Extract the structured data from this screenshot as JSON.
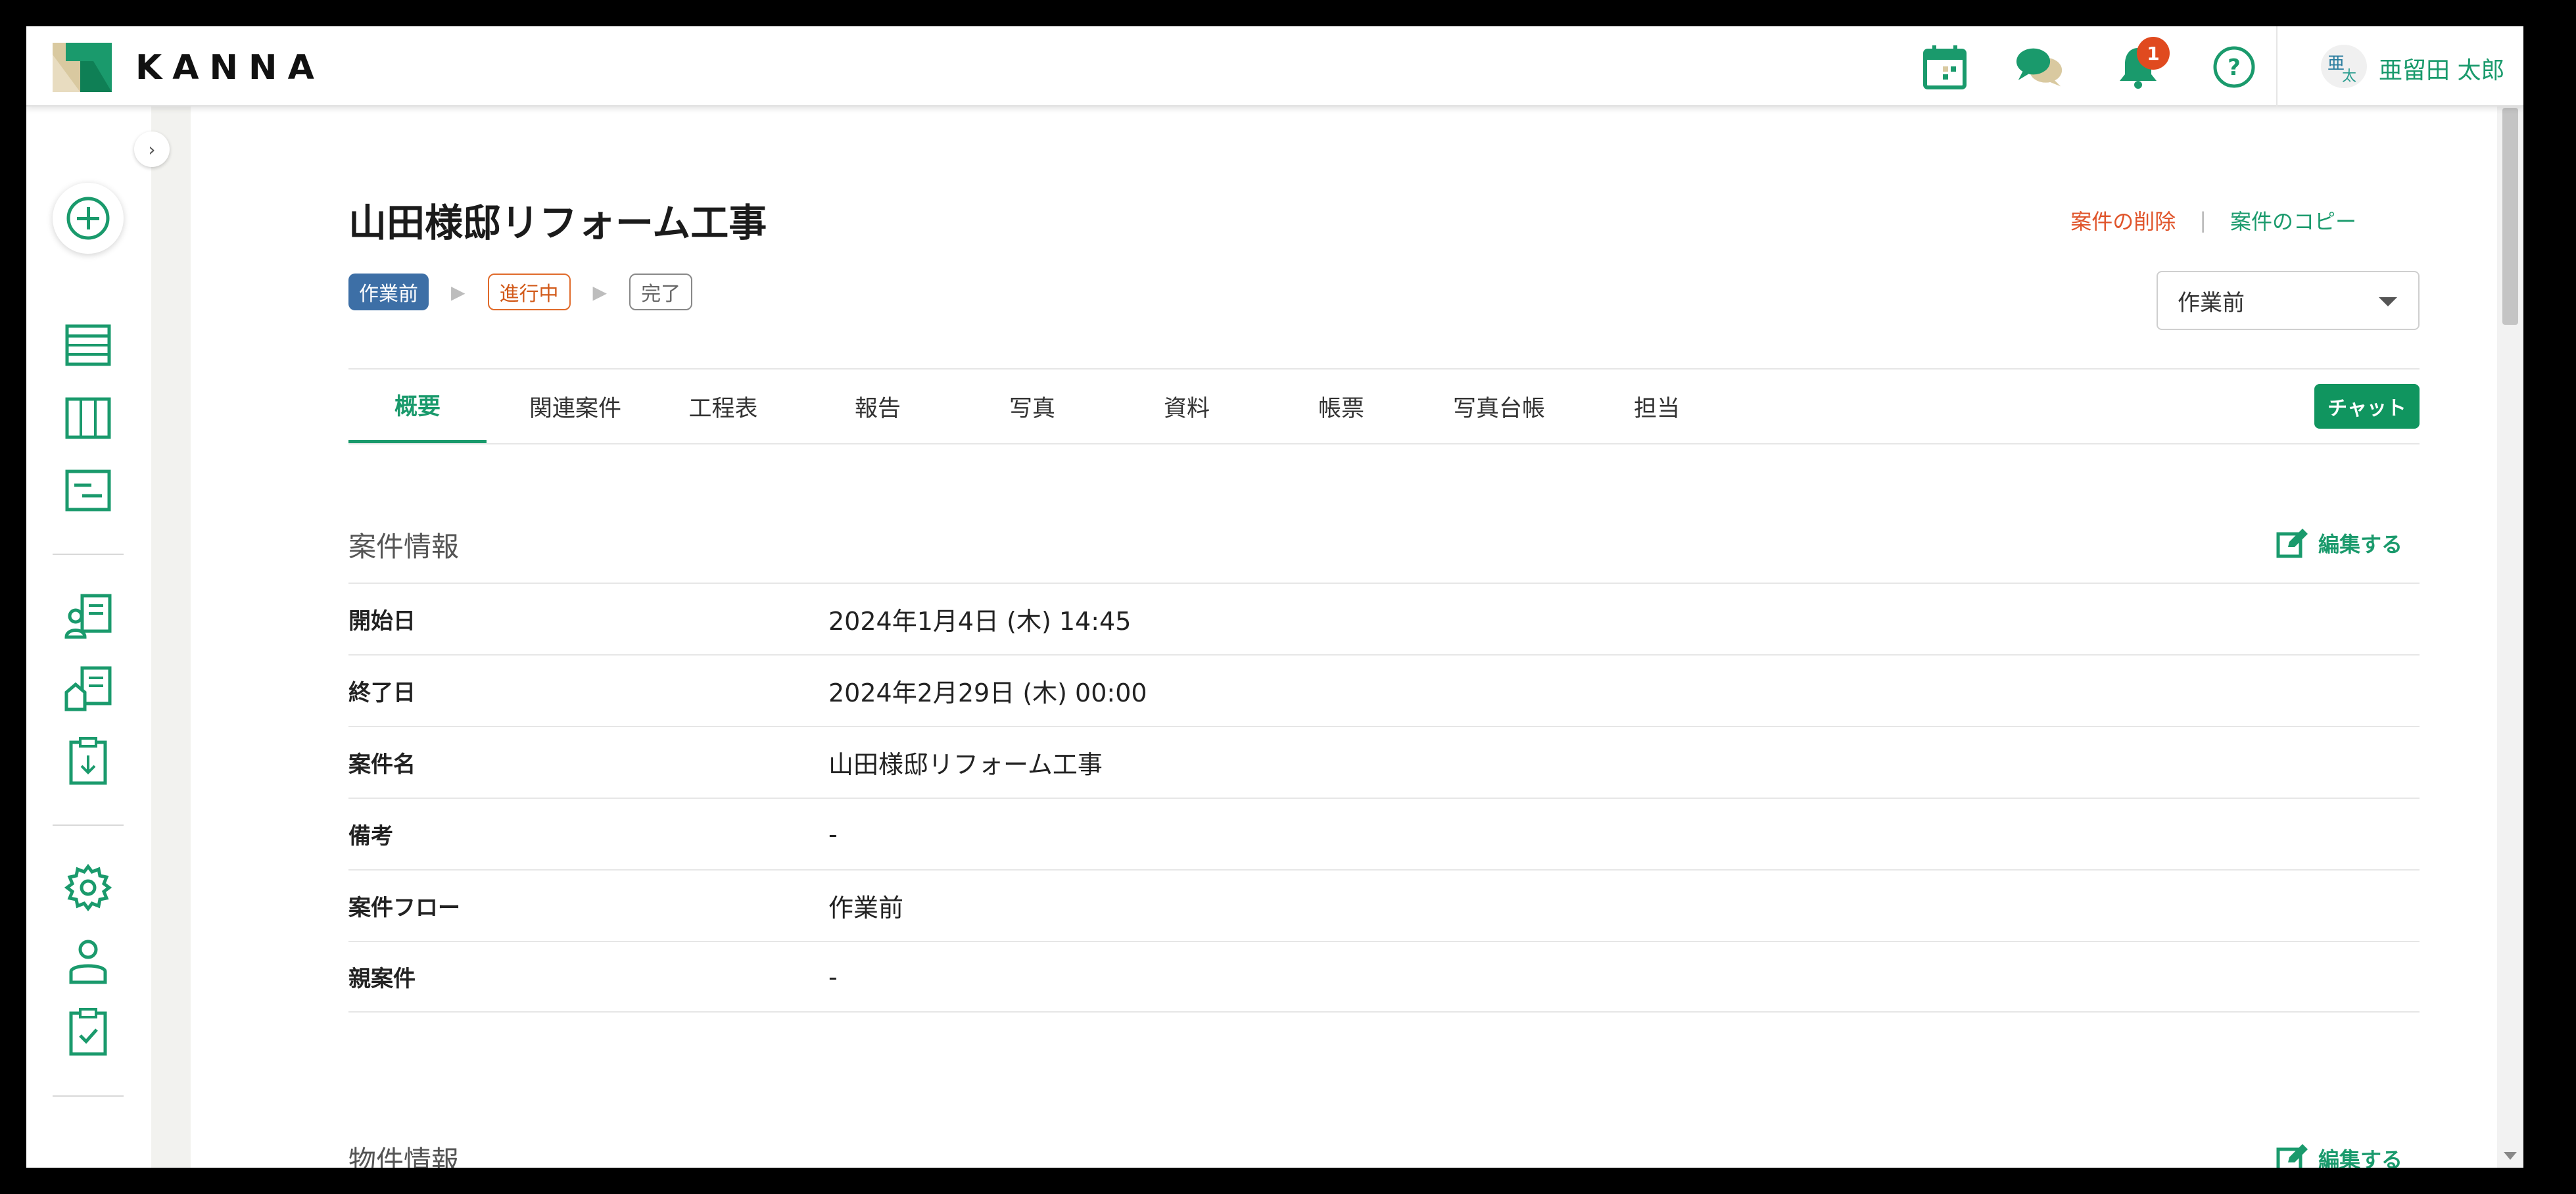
{
  "app": {
    "logo_text": "KANNA"
  },
  "header": {
    "notification_count": "1",
    "avatar_text_1": "亜",
    "avatar_text_2": "太",
    "user_name": "亜留田 太郎"
  },
  "page": {
    "title": "山田様邸リフォーム工事",
    "flow": [
      "作業前",
      "進行中",
      "完了"
    ],
    "delete_label": "案件の削除",
    "copy_label": "案件のコピー",
    "separator": "|",
    "status_select": "作業前"
  },
  "tabs": [
    "概要",
    "関連案件",
    "工程表",
    "報告",
    "写真",
    "資料",
    "帳票",
    "写真台帳",
    "担当"
  ],
  "chat_label": "チャット",
  "sections": {
    "case_info": {
      "title": "案件情報",
      "edit_label": "編集する",
      "rows": [
        {
          "label": "開始日",
          "value": "2024年1月4日 (木) 14:45"
        },
        {
          "label": "終了日",
          "value": "2024年2月29日 (木) 00:00"
        },
        {
          "label": "案件名",
          "value": "山田様邸リフォーム工事"
        },
        {
          "label": "備考",
          "value": "-"
        },
        {
          "label": "案件フロー",
          "value": "作業前"
        },
        {
          "label": "親案件",
          "value": "-"
        }
      ]
    },
    "property_info": {
      "title": "物件情報",
      "edit_label": "編集する"
    }
  },
  "colors": {
    "brand_green": "#1a9a6c",
    "danger": "#e0542a",
    "status_blue": "#3d6fa6"
  }
}
